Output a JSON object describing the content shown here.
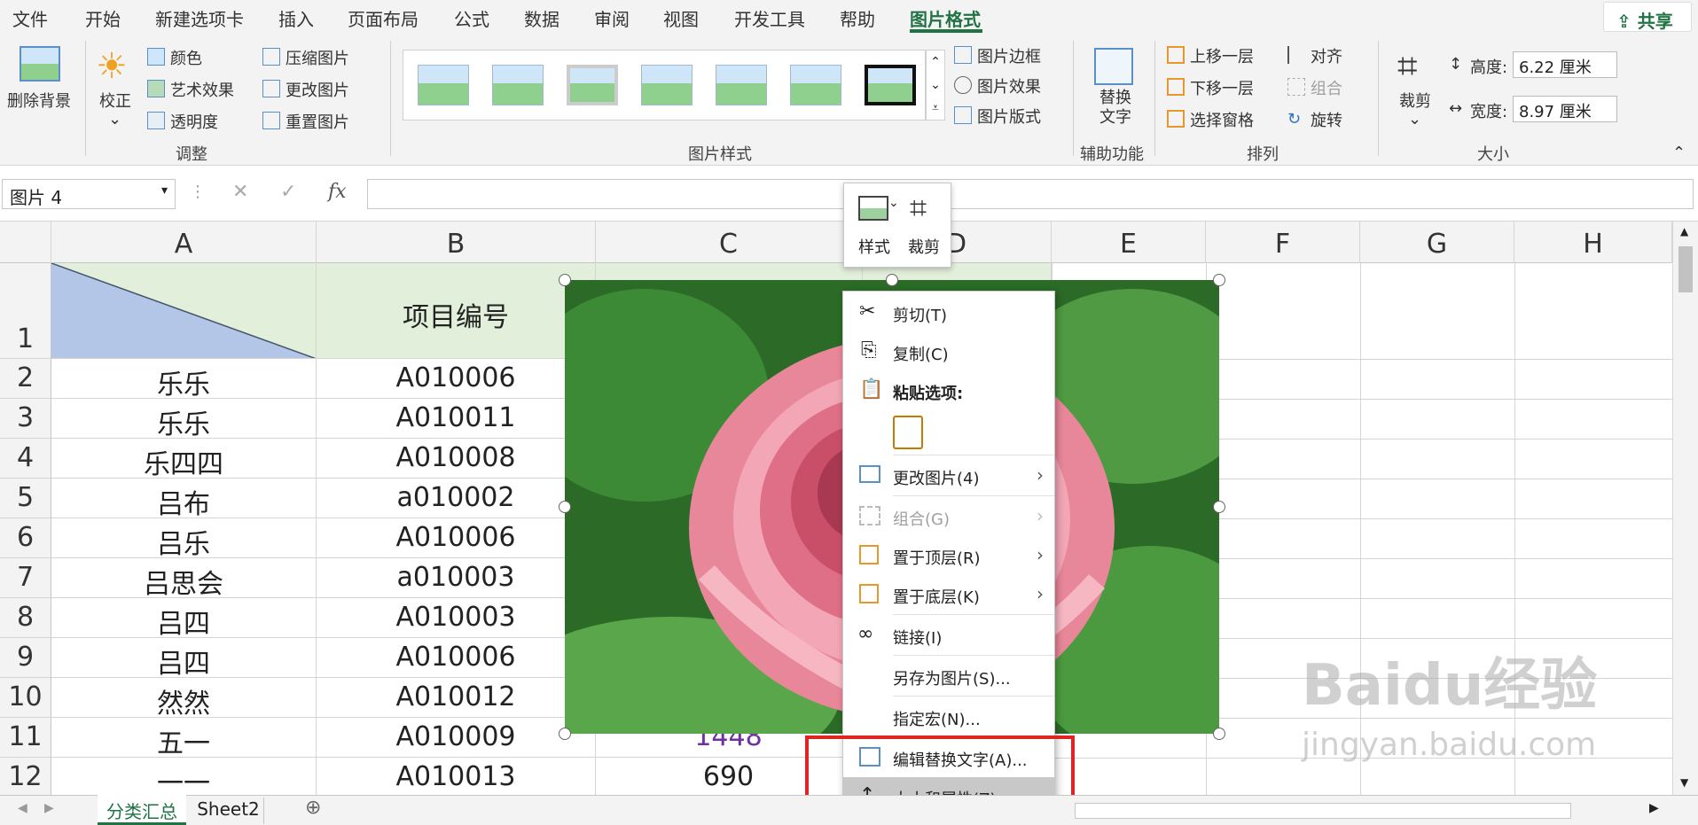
{
  "tabs": [
    "文件",
    "开始",
    "新建选项卡",
    "插入",
    "页面布局",
    "公式",
    "数据",
    "审阅",
    "视图",
    "开发工具",
    "帮助",
    "图片格式"
  ],
  "share_label": "共享",
  "ribbon": {
    "remove_bg": "删除背景",
    "correct": "校正",
    "color": "颜色",
    "artistic": "艺术效果",
    "transparency": "透明度",
    "compress": "压缩图片",
    "change": "更改图片",
    "reset": "重置图片",
    "border": "图片边框",
    "effects": "图片效果",
    "layout": "图片版式",
    "alt_text": "替换文字",
    "bring_forward": "上移一层",
    "send_backward": "下移一层",
    "selection_pane": "选择窗格",
    "align": "对齐",
    "group": "组合",
    "rotate": "旋转",
    "crop": "裁剪",
    "height_label": "高度:",
    "height_value": "6.22 厘米",
    "width_label": "宽度:",
    "width_value": "8.97 厘米",
    "groups": {
      "adjust": "调整",
      "styles": "图片样式",
      "accessibility": "辅助功能",
      "arrange": "排列",
      "size": "大小"
    }
  },
  "namebox": "图片 4",
  "fx": "fx",
  "columns": [
    "A",
    "B",
    "C",
    "D",
    "E",
    "F",
    "G",
    "H"
  ],
  "rows": [
    {
      "n": "1",
      "a": "",
      "b": "项目编号",
      "c": ""
    },
    {
      "n": "2",
      "a": "乐乐",
      "b": "A010006",
      "c": ""
    },
    {
      "n": "3",
      "a": "乐乐",
      "b": "A010011",
      "c": ""
    },
    {
      "n": "4",
      "a": "乐四四",
      "b": "A010008",
      "c": ""
    },
    {
      "n": "5",
      "a": "吕布",
      "b": "a010002",
      "c": ""
    },
    {
      "n": "6",
      "a": "吕乐",
      "b": "A010006",
      "c": ""
    },
    {
      "n": "7",
      "a": "吕思会",
      "b": "a010003",
      "c": ""
    },
    {
      "n": "8",
      "a": "吕四",
      "b": "A010003",
      "c": ""
    },
    {
      "n": "9",
      "a": "吕四",
      "b": "A010006",
      "c": ""
    },
    {
      "n": "10",
      "a": "然然",
      "b": "A010012",
      "c": ""
    },
    {
      "n": "11",
      "a": "五一",
      "b": "A010009",
      "c": "1448"
    },
    {
      "n": "12",
      "a": "一一",
      "b": "A010013",
      "c": "690"
    }
  ],
  "mini_toolbar": {
    "style": "样式",
    "crop": "裁剪"
  },
  "menu": {
    "cut": "剪切(T)",
    "copy": "复制(C)",
    "paste_options": "粘贴选项:",
    "change_picture": "更改图片(4)",
    "group": "组合(G)",
    "bring_front": "置于顶层(R)",
    "send_back": "置于底层(K)",
    "link": "链接(I)",
    "save_as": "另存为图片(S)...",
    "macro": "指定宏(N)...",
    "edit_alt": "编辑替换文字(A)...",
    "size_props": "大小和属性(Z)..."
  },
  "sheets": [
    "分类汇总",
    "Sheet2"
  ],
  "watermark": "Baidu经验",
  "watermark_url": "jingyan.baidu.com",
  "colors": {
    "accent": "#217346",
    "header_fill": "#e2efda",
    "diag_fill": "#b4c6e7",
    "highlight_box": "#e02424",
    "purple_value": "#7030a0"
  }
}
